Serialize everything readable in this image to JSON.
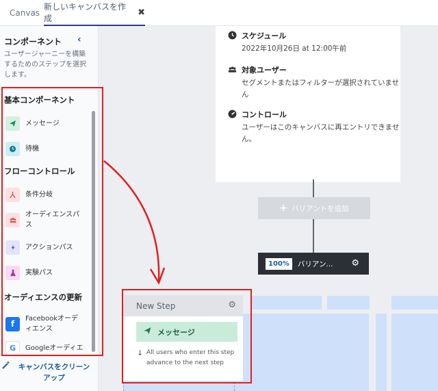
{
  "tabs": [
    {
      "label": "Canvas"
    },
    {
      "label": "新しいキャンバスを作成",
      "close": "✖"
    }
  ],
  "sidebar": {
    "title": "コンポーネント",
    "collapse_icon": "chevron-left-icon",
    "description": "ユーザージャーニーを構築するためのステップを選択します。",
    "sections": [
      {
        "title": "基本コンポーネント",
        "items": [
          {
            "label": "メッセージ",
            "icon": "paper-plane-icon",
            "bg": "#d3f0e0",
            "fg": "#1f8a5a"
          },
          {
            "label": "待機",
            "icon": "clock-icon",
            "bg": "#cdeef6",
            "fg": "#1b7f9a"
          }
        ]
      },
      {
        "title": "フローコントロール",
        "items": [
          {
            "label": "条件分岐",
            "icon": "split-icon",
            "bg": "#fde0e0",
            "fg": "#d9534f"
          },
          {
            "label": "オーディエンスパス",
            "icon": "users-icon",
            "bg": "#fde0e0",
            "fg": "#d9534f"
          },
          {
            "label": "アクションパス",
            "icon": "bolt-icon",
            "bg": "#e3e4fb",
            "fg": "#4b4fc4"
          },
          {
            "label": "実験パス",
            "icon": "flask-icon",
            "bg": "#f6dbf2",
            "fg": "#a8389a"
          }
        ]
      },
      {
        "title": "オーディエンスの更新",
        "items": [
          {
            "label": "Facebookオーディエンス",
            "icon": "facebook-icon",
            "bg": "#1877f2",
            "fg": "#ffffff"
          },
          {
            "label": "Googleオーディエ",
            "icon": "google-icon",
            "bg": "#ffffff",
            "fg": "#4285f4"
          }
        ]
      }
    ],
    "cleanup_label": "キャンバスをクリーンアップ"
  },
  "entry": {
    "schedule": {
      "title": "スケジュール",
      "text": "2022年10月26日 at 12:00午前"
    },
    "audience": {
      "title": "対象ユーザー",
      "text": "セグメントまたはフィルターが選択されていません"
    },
    "controls": {
      "title": "コントロール",
      "text": "ユーザーはこのキャンバスに再エントリできません。"
    }
  },
  "add_variant": {
    "label": "バリアントを追加"
  },
  "variant": {
    "percent": "100%",
    "name": "バリアン..."
  },
  "new_step": {
    "title": "New Step",
    "message_label": "メッセージ",
    "hint": "All users who enter this step advance to the next step"
  },
  "colors": {
    "annotation": "#e01e1e",
    "accent": "#1a5c9e"
  }
}
